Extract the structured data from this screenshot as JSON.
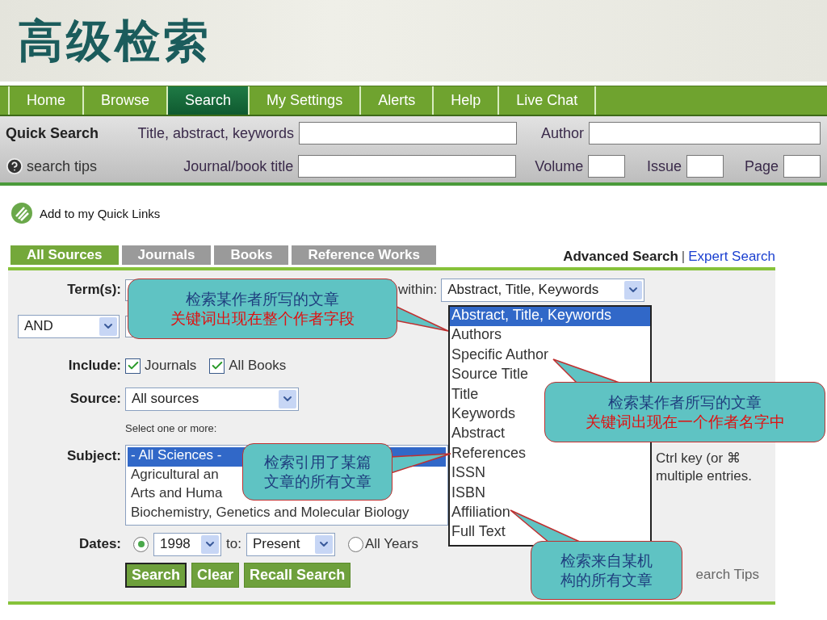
{
  "slide_title": "高级检索",
  "nav": {
    "tabs": [
      {
        "label": "Home",
        "selected": false
      },
      {
        "label": "Browse",
        "selected": false
      },
      {
        "label": "Search",
        "selected": true
      },
      {
        "label": "My Settings",
        "selected": false
      },
      {
        "label": "Alerts",
        "selected": false
      },
      {
        "label": "Help",
        "selected": false
      },
      {
        "label": "Live Chat",
        "selected": false
      }
    ]
  },
  "quick_search": {
    "heading": "Quick Search",
    "help": "search tips",
    "rows": [
      [
        {
          "label": "Title, abstract, keywords",
          "kind": "wide"
        },
        {
          "label": "Author",
          "kind": "fill"
        }
      ],
      [
        {
          "label": "Journal/book title",
          "kind": "wide"
        },
        {
          "label": "Volume",
          "kind": "small"
        },
        {
          "label": "Issue",
          "kind": "small"
        },
        {
          "label": "Page",
          "kind": "small"
        }
      ]
    ]
  },
  "quick_links": "Add to my Quick Links",
  "source_tabs": [
    {
      "label": "All Sources",
      "selected": true
    },
    {
      "label": "Journals",
      "selected": false
    },
    {
      "label": "Books",
      "selected": false
    },
    {
      "label": "Reference Works",
      "selected": false
    }
  ],
  "search_mode_separator": "|",
  "search_modes": [
    {
      "label": "Advanced Search",
      "selected": true
    },
    {
      "label": "Expert Search",
      "selected": false
    }
  ],
  "form": {
    "terms_label": "Term(s):",
    "within_label": "within:",
    "within_value": "Abstract, Title, Keywords",
    "operator": "AND",
    "include_label": "Include:",
    "include": [
      {
        "label": "Journals",
        "checked": true
      },
      {
        "label": "All Books",
        "checked": true
      }
    ],
    "source_label": "Source:",
    "source_value": "All sources",
    "subject_hint": "Select one or more:",
    "subject_label": "Subject:",
    "subjects": [
      {
        "text": "- All Sciences -",
        "selected": true
      },
      {
        "text": "Agricultural an",
        "selected": false
      },
      {
        "text": "Arts and Huma",
        "selected": false
      },
      {
        "text": "Biochemistry, Genetics and Molecular Biology",
        "selected": false
      }
    ],
    "note": [
      "Ctrl key (or ⌘",
      "multiple entries."
    ],
    "dates_label": "Dates:",
    "date_range": {
      "selected": true,
      "from": "1998",
      "to_label": "to:",
      "to": "Present"
    },
    "all_years": {
      "label": "All Years",
      "selected": false
    },
    "buttons": [
      {
        "label": "Search",
        "selected": true
      },
      {
        "label": "Clear",
        "selected": false
      },
      {
        "label": "Recall Search",
        "selected": false
      }
    ],
    "tips": "earch Tips"
  },
  "within_options": [
    {
      "text": "Abstract, Title, Keywords",
      "selected": true
    },
    {
      "text": "Authors",
      "selected": false
    },
    {
      "text": "Specific Author",
      "selected": false
    },
    {
      "text": "Source Title",
      "selected": false
    },
    {
      "text": "Title",
      "selected": false
    },
    {
      "text": "Keywords",
      "selected": false
    },
    {
      "text": "Abstract",
      "selected": false
    },
    {
      "text": "References",
      "selected": false
    },
    {
      "text": "ISSN",
      "selected": false
    },
    {
      "text": "ISBN",
      "selected": false
    },
    {
      "text": "Affiliation",
      "selected": false
    },
    {
      "text": "Full Text",
      "selected": false
    }
  ],
  "callouts": [
    {
      "lines": [
        {
          "text": "检索某作者所写的文章",
          "color": "#1f3f7f"
        },
        {
          "text": "关键词出现在整个作者字段",
          "color": "#e01010"
        }
      ]
    },
    {
      "lines": [
        {
          "text": "检索某作者所写的文章",
          "color": "#1f3f7f"
        },
        {
          "text": "关键词出现在一个作者名字中",
          "color": "#e01010"
        }
      ]
    },
    {
      "lines": [
        {
          "text": "检索引用了某篇",
          "color": "#1f3f7f"
        },
        {
          "text": "文章的所有文章",
          "color": "#1f3f7f"
        }
      ]
    },
    {
      "lines": [
        {
          "text": "检索来自某机",
          "color": "#1f3f7f"
        },
        {
          "text": "构的所有文章",
          "color": "#1f3f7f"
        }
      ]
    }
  ]
}
